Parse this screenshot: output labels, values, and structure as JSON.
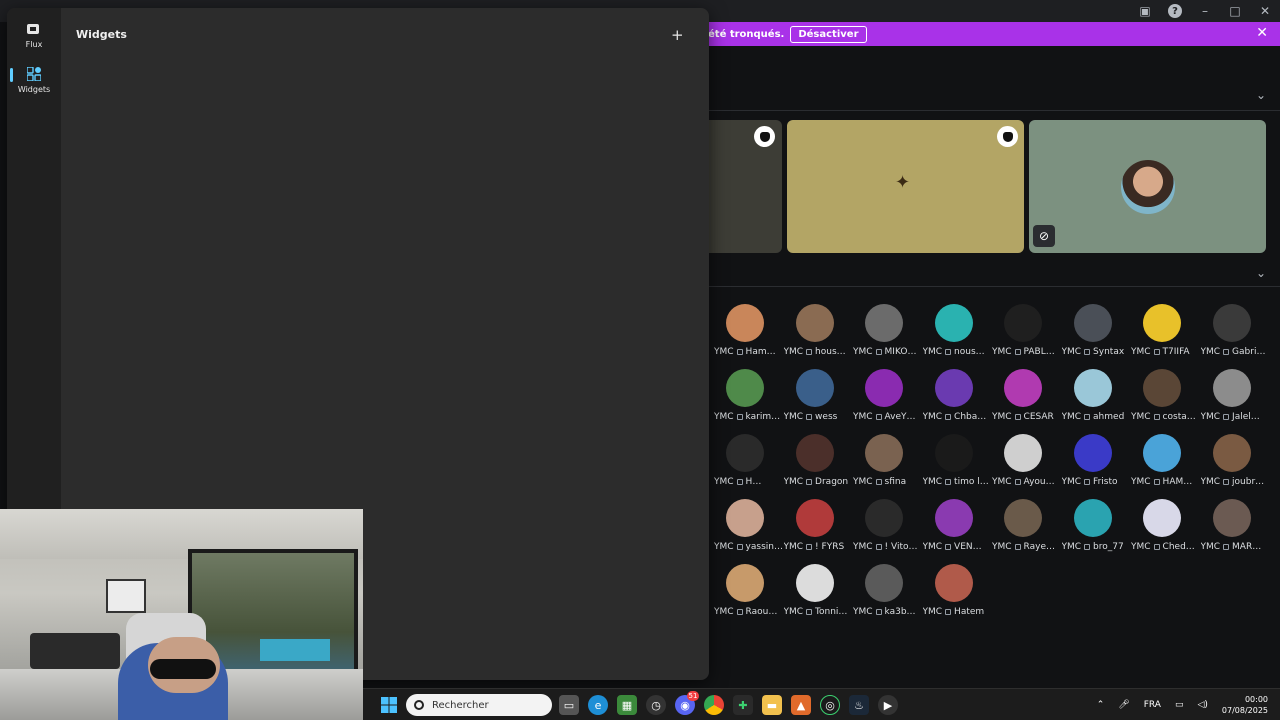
{
  "banner": {
    "message": "été tronqués.",
    "button": "Désactiver"
  },
  "widgets_panel": {
    "title": "Widgets",
    "rail": [
      {
        "label": "Flux",
        "icon": "flux-icon"
      },
      {
        "label": "Widgets",
        "icon": "widgets-icon"
      }
    ]
  },
  "member_tag": "YMC",
  "members": [
    [
      "Ham…",
      "hous…",
      "MIKO…",
      "nous…",
      "PABL…",
      "Syntax",
      "T7IIFA",
      "Gabri…"
    ],
    [
      "karim…",
      "wess",
      "AveY…",
      "Chba…",
      "CESAR",
      "ahmed",
      "costa…",
      "Jalel…"
    ],
    [
      "H…",
      "Dragon",
      "sfina",
      "timo l…",
      "Ayou…",
      "Fristo",
      "HAM…",
      "joubr…"
    ],
    [
      "yassin…",
      "! FYRS",
      "! Vito…",
      "VEN…",
      "Raye…",
      "bro_77",
      "Ched…",
      "MAR…"
    ],
    [
      "Raou…",
      "Tonni…",
      "ka3b…",
      "Hatem"
    ]
  ],
  "member_colors": [
    [
      "#c9865a",
      "#8a6b52",
      "#6b6b6b",
      "#2ab2b0",
      "#1f1f1f",
      "#4a4f57",
      "#e8c12a",
      "#3a3a3a"
    ],
    [
      "#4f8a4a",
      "#3a5f8a",
      "#8a2bb0",
      "#6a3ab0",
      "#b03ab0",
      "#9ac7d8",
      "#5a4636",
      "#8c8c8c"
    ],
    [
      "#2a2a2a",
      "#4b2f2a",
      "#7a6250",
      "#1a1a1a",
      "#cfcfcf",
      "#3a3ac7",
      "#4aa3d8",
      "#7a5a42"
    ],
    [
      "#c7a08c",
      "#b03a3a",
      "#2a2a2a",
      "#8a3ab0",
      "#6a5a4a",
      "#2aa3b0",
      "#d8d8e8",
      "#6b5a52"
    ],
    [
      "#c79a6a",
      "#dcdcdc",
      "#5a5a5a",
      "#b05a4a"
    ]
  ],
  "taskbar": {
    "search_placeholder": "Rechercher",
    "language": "FRA",
    "time": "00:00",
    "date": "07/08/2025",
    "discord_badge": "51"
  }
}
